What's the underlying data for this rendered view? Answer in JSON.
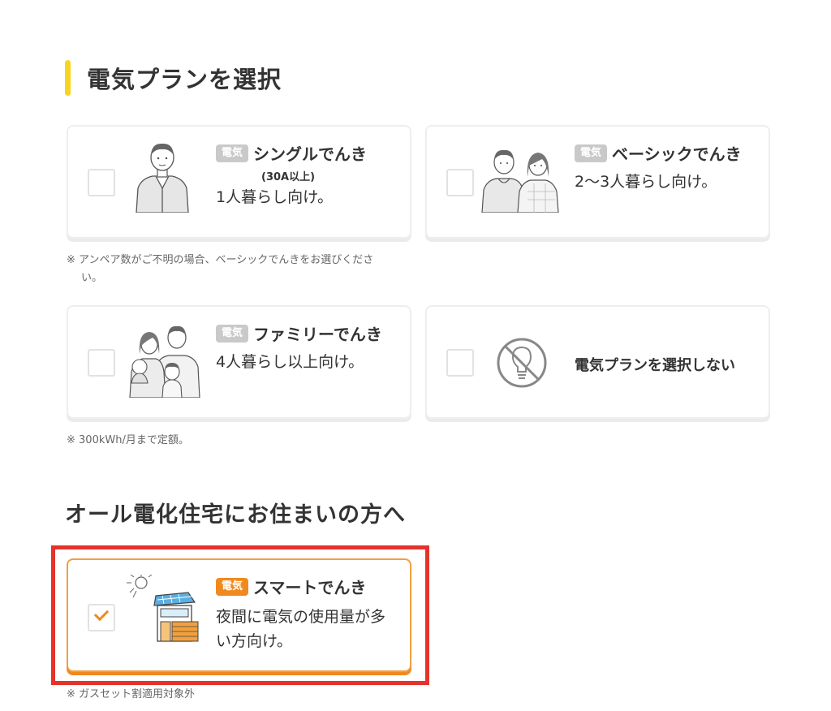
{
  "section": {
    "title": "電気プランを選択"
  },
  "plans": [
    {
      "badge": "電気",
      "name": "シングルでんき",
      "sub": "(30A以上)",
      "desc": "1人暮らし向け。"
    },
    {
      "badge": "電気",
      "name": "ベーシックでんき",
      "desc": "2〜3人暮らし向け。"
    },
    {
      "badge": "電気",
      "name": "ファミリーでんき",
      "desc": "4人暮らし以上向け。"
    },
    {
      "label": "電気プランを選択しない"
    }
  ],
  "notes": {
    "amp": "※ アンペア数がご不明の場合、ベーシックでんきをお選びください。",
    "amp_line1": "※ アンペア数がご不明の場合、ベーシックでんきをお選びくださ",
    "amp_line2": "い。",
    "flat": "※ 300kWh/月まで定額。",
    "gas": "※ ガスセット割適用対象外"
  },
  "all_electric": {
    "heading": "オール電化住宅にお住まいの方へ",
    "plan": {
      "badge": "電気",
      "name": "スマートでんき",
      "desc_line1": "夜間に電気の使用量が多",
      "desc_line2": "い方向け。",
      "checked": true
    }
  },
  "colors": {
    "accent_yellow": "#f7d51d",
    "accent_orange": "#f08a1e",
    "highlight_red": "#e5322b",
    "badge_gray": "#c9c9c9"
  },
  "icons": [
    "single-person-icon",
    "couple-icon",
    "family-icon",
    "no-electricity-icon",
    "smart-house-icon",
    "check-icon"
  ]
}
